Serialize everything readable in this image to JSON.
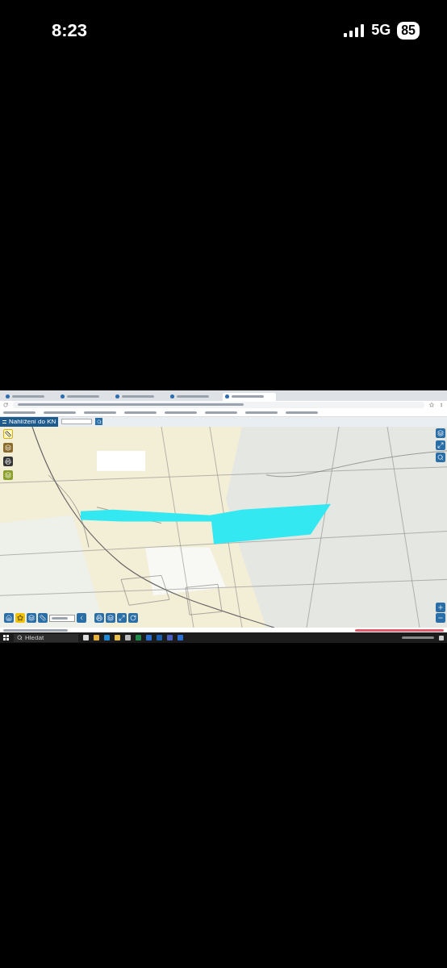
{
  "status_bar": {
    "time": "8:23",
    "network": "5G",
    "battery": "85"
  },
  "browser": {
    "tabs": [
      {
        "selected": false
      },
      {
        "selected": false
      },
      {
        "selected": false
      },
      {
        "selected": false
      },
      {
        "selected": true
      }
    ]
  },
  "map_app": {
    "title": "Nahlížení do KN"
  },
  "taskbar": {
    "search_placeholder": "Hledat"
  }
}
